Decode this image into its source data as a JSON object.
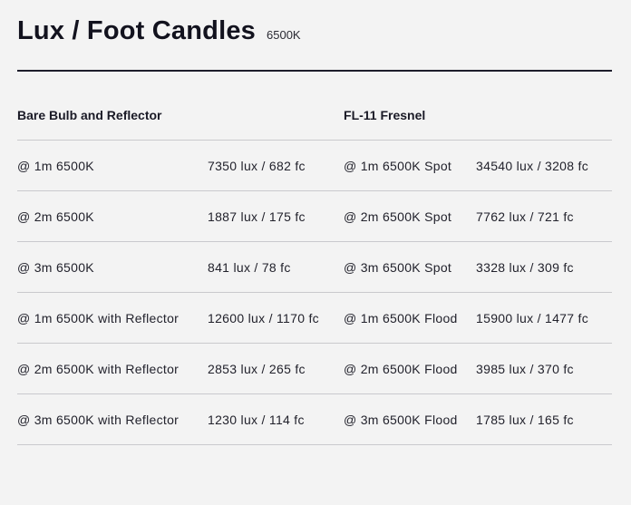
{
  "header": {
    "title": "Lux / Foot Candles",
    "subtitle": "6500K"
  },
  "table": {
    "headers": {
      "left": "Bare Bulb and Reflector",
      "right": "FL-11 Fresnel"
    },
    "rows": [
      {
        "left_label": "@ 1m 6500K",
        "left_value": "7350 lux / 682 fc",
        "right_label": "@ 1m 6500K Spot",
        "right_value": "34540 lux / 3208 fc"
      },
      {
        "left_label": "@ 2m 6500K",
        "left_value": "1887 lux / 175 fc",
        "right_label": "@ 2m 6500K Spot",
        "right_value": "7762 lux / 721 fc"
      },
      {
        "left_label": "@ 3m 6500K",
        "left_value": "841 lux / 78 fc",
        "right_label": "@ 3m 6500K Spot",
        "right_value": "3328 lux / 309 fc"
      },
      {
        "left_label": "@ 1m 6500K with Reflector",
        "left_value": "12600 lux / 1170 fc",
        "right_label": "@ 1m 6500K Flood",
        "right_value": "15900 lux / 1477 fc"
      },
      {
        "left_label": "@ 2m 6500K with Reflector",
        "left_value": "2853 lux / 265 fc",
        "right_label": "@ 2m 6500K Flood",
        "right_value": "3985 lux / 370 fc"
      },
      {
        "left_label": "@ 3m 6500K with Reflector",
        "left_value": "1230 lux / 114 fc",
        "right_label": "@ 3m 6500K Flood",
        "right_value": "1785 lux / 165 fc"
      }
    ]
  }
}
